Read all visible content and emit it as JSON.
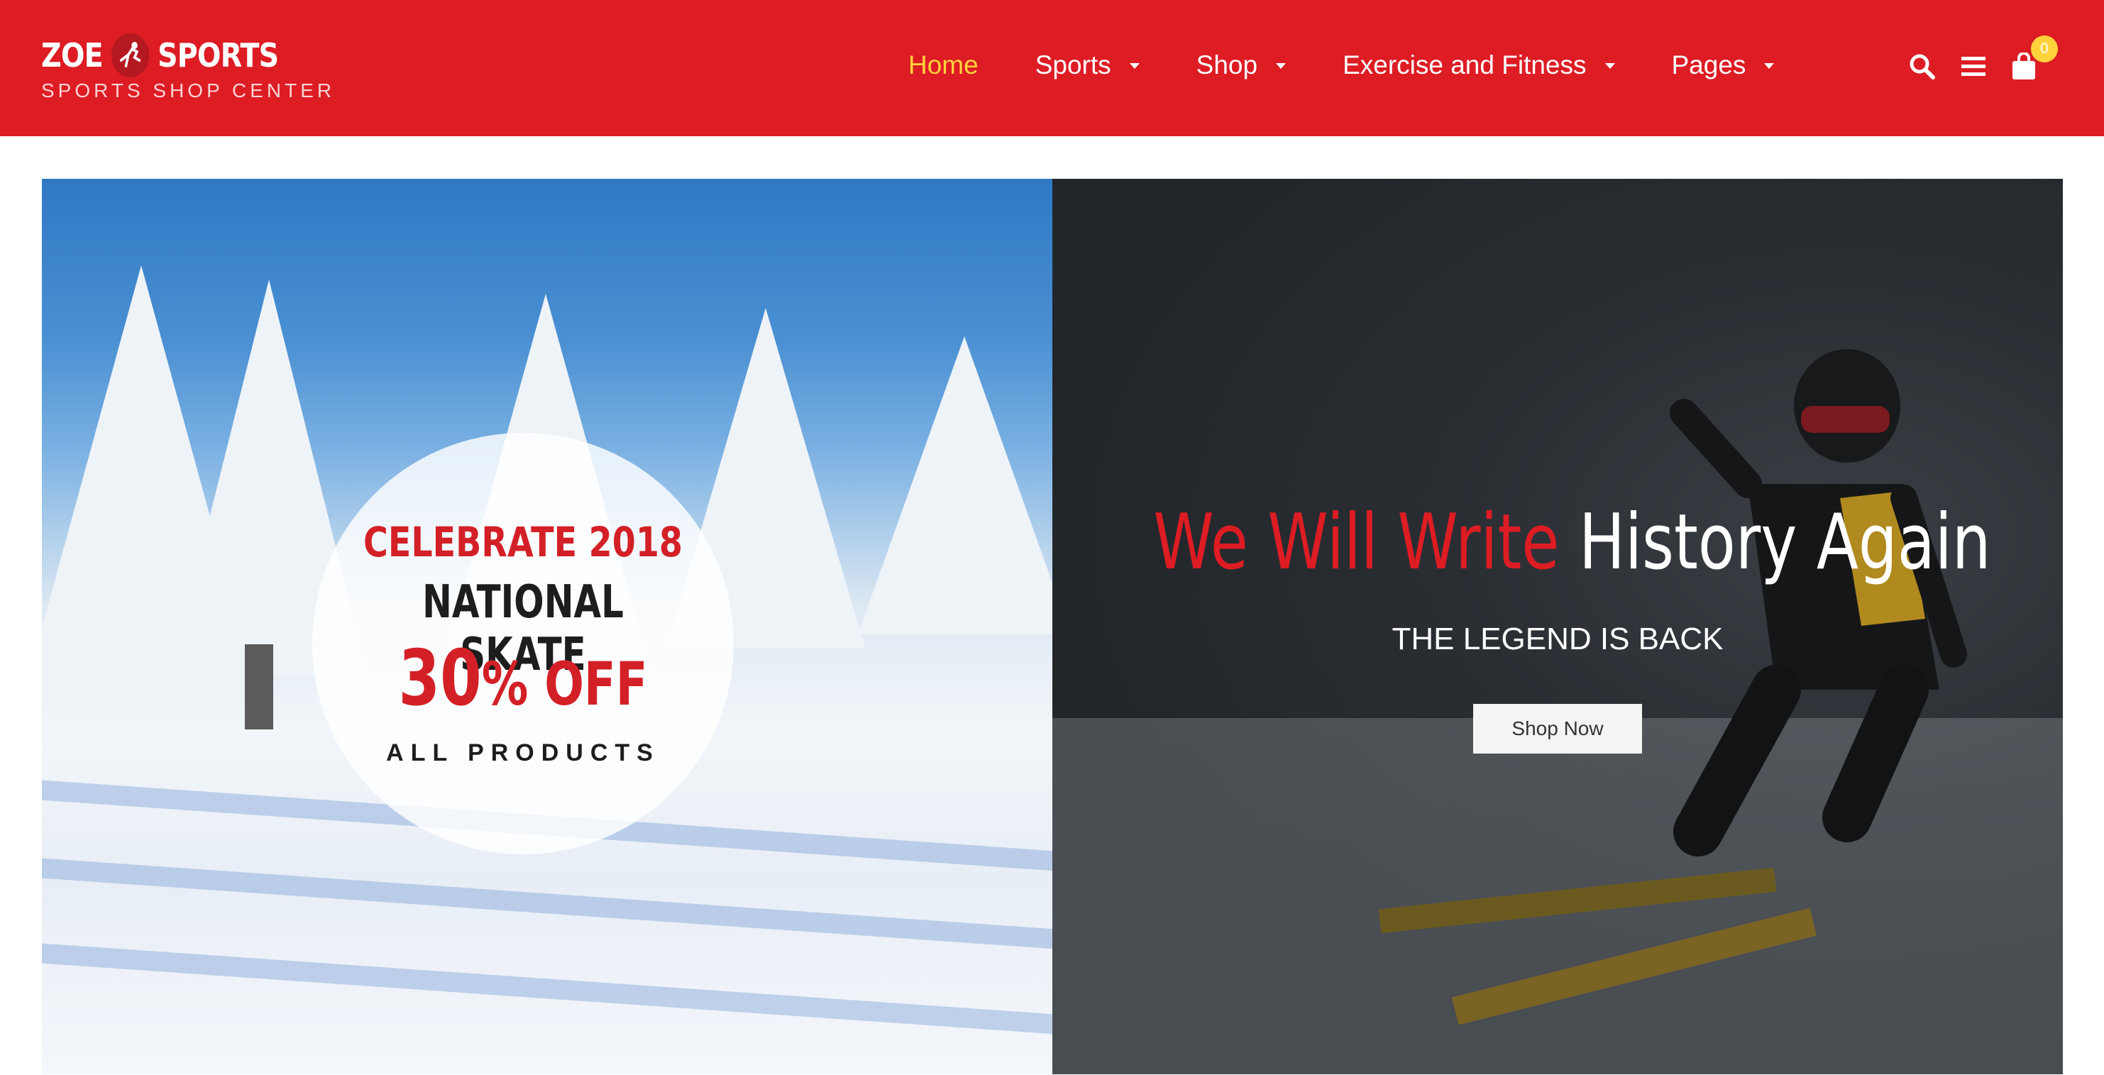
{
  "brand": {
    "name_left": "ZOE",
    "name_right": "SPORTS",
    "tagline": "SPORTS SHOP CENTER"
  },
  "nav": {
    "items": [
      {
        "label": "Home",
        "active": true,
        "has_dropdown": false
      },
      {
        "label": "Sports",
        "active": false,
        "has_dropdown": true
      },
      {
        "label": "Shop",
        "active": false,
        "has_dropdown": true
      },
      {
        "label": "Exercise and Fitness",
        "active": false,
        "has_dropdown": true
      },
      {
        "label": "Pages",
        "active": false,
        "has_dropdown": true
      }
    ]
  },
  "tools": {
    "search_icon": "search-icon",
    "menu_icon": "menu-icon",
    "cart_icon": "shopping-bag-icon",
    "cart_count": "0"
  },
  "promo": {
    "line1": "CELEBRATE 2018",
    "line2": "NATIONAL SKATE",
    "discount": "30",
    "discount_suffix": "% OFF",
    "line4": "ALL PRODUCTS"
  },
  "hero": {
    "title_red": "We Will Write",
    "title_white": "History Again",
    "subtitle": "THE LEGEND IS BACK",
    "cta_label": "Shop Now"
  },
  "colors": {
    "brand_red": "#dd1c24",
    "nav_active": "#ffd23c",
    "badge": "#ffd23c"
  }
}
